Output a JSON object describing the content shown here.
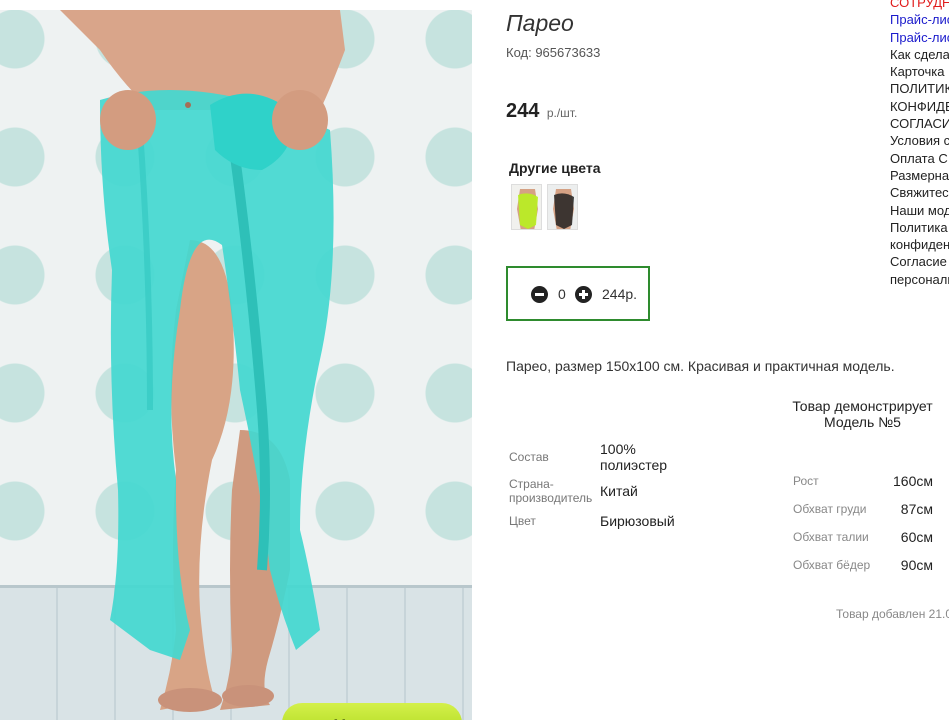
{
  "product": {
    "title": "Парео",
    "code": "Код: 965673633",
    "price": "244",
    "price_unit": "р./шт.",
    "other_colors_title": "Другие цвета",
    "description": "Парео, размер 150x100 см. Красивая и практичная модель.",
    "zoom_button": "+ Увеличить",
    "added_text": "Товар добавлен 21.0"
  },
  "quantity": {
    "value": "0",
    "sum": "244р."
  },
  "specs": [
    {
      "label": "Состав",
      "value": "100% полиэстер"
    },
    {
      "label": "Страна-производитель",
      "value": "Китай"
    },
    {
      "label": "Цвет",
      "value": "Бирюзовый"
    }
  ],
  "model": {
    "heading": "Товар демонстрирует Модель №5",
    "params": [
      {
        "label": "Рост",
        "value": "160см"
      },
      {
        "label": "Обхват груди",
        "value": "87см"
      },
      {
        "label": "Обхват талии",
        "value": "60см"
      },
      {
        "label": "Обхват бёдер",
        "value": "90см"
      }
    ]
  },
  "side_menu": [
    {
      "text": "СОТРУДНИ",
      "color": "red"
    },
    {
      "text": "Прайс-лист",
      "color": "blue"
    },
    {
      "text": "Прайс-лист",
      "color": "blue"
    },
    {
      "text": "Как сделать",
      "color": "dark"
    },
    {
      "text": "Карточка",
      "color": "dark"
    },
    {
      "text": "ПОЛИТИКА",
      "color": "dark"
    },
    {
      "text": "КОНФИДЕНЦ",
      "color": "dark"
    },
    {
      "text": "СОГЛАСИЕ",
      "color": "dark"
    },
    {
      "text": "Условия с",
      "color": "dark"
    },
    {
      "text": "Оплата С",
      "color": "dark"
    },
    {
      "text": "Размерная",
      "color": "dark"
    },
    {
      "text": "Свяжитесь",
      "color": "dark"
    },
    {
      "text": "Наши мод",
      "color": "dark"
    },
    {
      "text": "Политика",
      "color": "dark"
    },
    {
      "text": "конфиденц",
      "color": "dark"
    },
    {
      "text": "Согласие",
      "color": "dark"
    },
    {
      "text": "персональ",
      "color": "dark"
    }
  ],
  "colors": {
    "accent_green": "#2e8b2e",
    "pareo": "#3ed6cf",
    "menu_red": "#e01b1b",
    "menu_blue": "#1a1acc"
  }
}
